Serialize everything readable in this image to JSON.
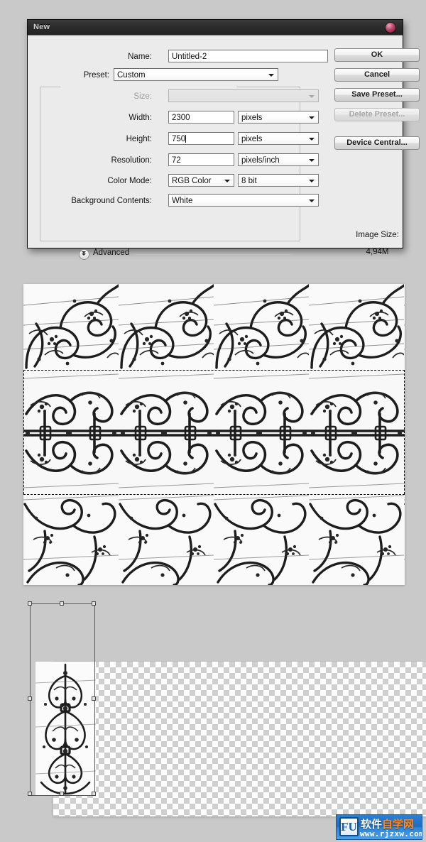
{
  "dialog": {
    "title": "New",
    "close_icon": "close-circle-icon",
    "fields": {
      "name_label": "Name:",
      "name_value": "Untitled-2",
      "preset_label": "Preset:",
      "preset_value": "Custom",
      "size_label": "Size:",
      "size_value": "",
      "width_label": "Width:",
      "width_value": "2300",
      "width_unit": "pixels",
      "height_label": "Height:",
      "height_value": "750",
      "height_unit": "pixels",
      "resolution_label": "Resolution:",
      "resolution_value": "72",
      "resolution_unit": "pixels/inch",
      "color_mode_label": "Color Mode:",
      "color_mode_value": "RGB Color",
      "color_depth_value": "8 bit",
      "background_label": "Background Contents:",
      "background_value": "White"
    },
    "advanced": {
      "label": "Advanced",
      "toggle_icon": "chevron-double-down-icon"
    },
    "image_size": {
      "label": "Image Size:",
      "value": "4,94M"
    },
    "buttons": {
      "ok": "OK",
      "cancel": "Cancel",
      "save_preset": "Save Preset...",
      "delete_preset": "Delete Preset...",
      "device_central": "Device Central..."
    }
  },
  "watermark": {
    "logo_text": "FU",
    "cn_part1": "软件",
    "cn_part2": "自学网",
    "url": "www.rjzxw.com",
    "bg_color": "#2f7fd0",
    "accent_color": "#ff8a1f"
  },
  "colors": {
    "page_background": "#c9c9c9",
    "dialog_background": "#ebebeb",
    "titlebar": "#2c2c2c",
    "close_button": "#c24b72"
  }
}
